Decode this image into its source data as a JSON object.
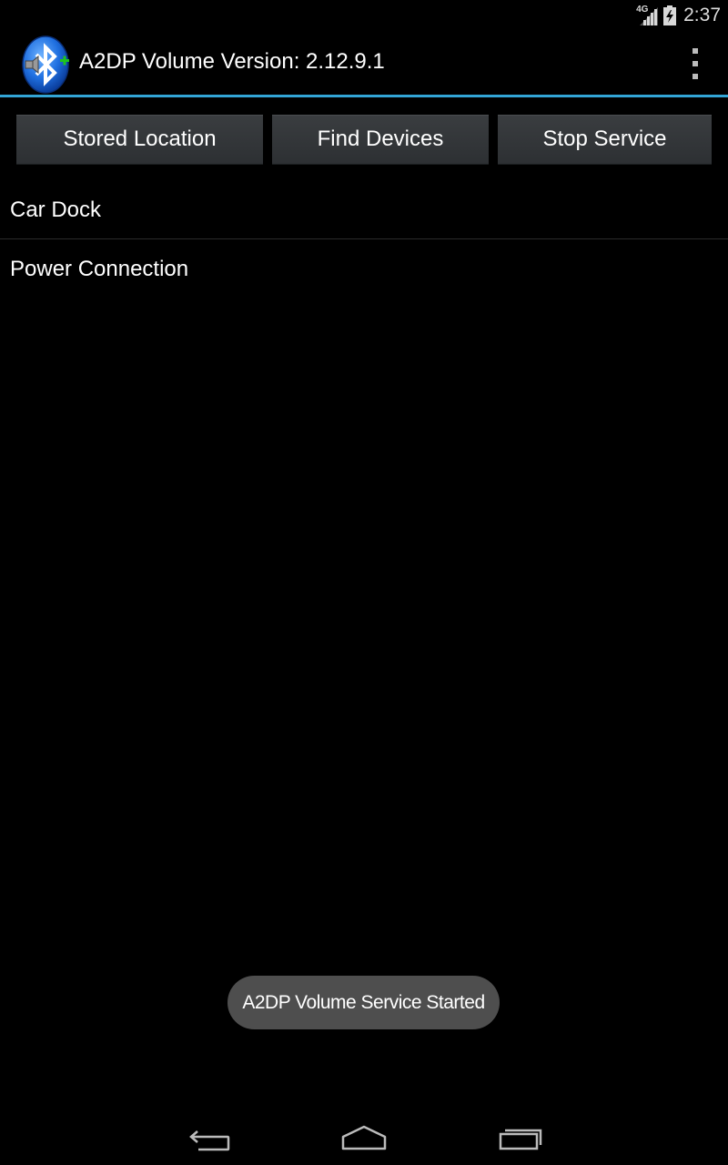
{
  "status_bar": {
    "network_type": "4G",
    "time": "2:37"
  },
  "action_bar": {
    "app_icon": "bluetooth-volume-icon",
    "title": "A2DP Volume Version: 2.12.9.1",
    "overflow_icon": "overflow-menu-icon",
    "accent_color": "#33a5d6"
  },
  "buttons": {
    "stored_location": "Stored Location",
    "find_devices": "Find Devices",
    "stop_service": "Stop Service"
  },
  "list": {
    "items": [
      {
        "label": "Car Dock"
      },
      {
        "label": "Power Connection"
      }
    ]
  },
  "toast": {
    "message": "A2DP Volume Service Started"
  },
  "nav_bar": {
    "back_icon": "back-icon",
    "home_icon": "home-icon",
    "recent_icon": "recent-apps-icon"
  }
}
